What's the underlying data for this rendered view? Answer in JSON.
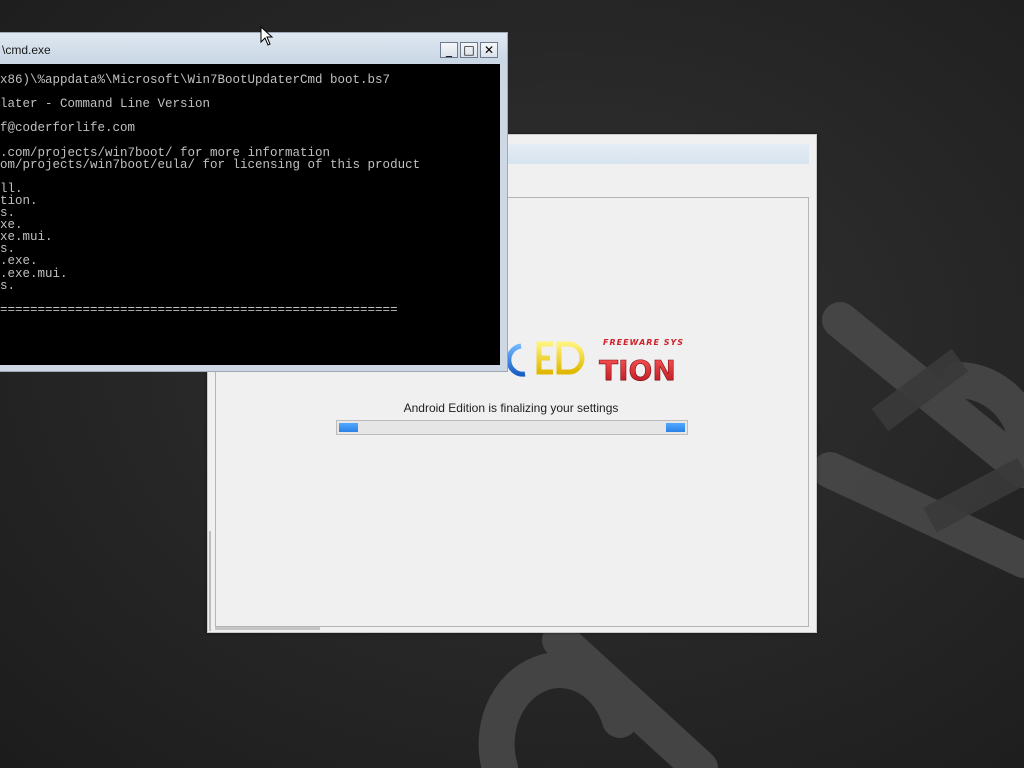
{
  "cmd_window": {
    "title": "\\cmd.exe",
    "minimize_glyph": "_",
    "maximize_glyph": "□",
    "close_glyph": "✕",
    "lines": [
      "x86)\\%appdata%\\Microsoft\\Win7BootUpdaterCmd boot.bs7",
      "",
      "later - Command Line Version",
      "",
      "f@coderforlife.com",
      "",
      ".com/projects/win7boot/ for more information",
      "om/projects/win7boot/eula/ for licensing of this product",
      "",
      "ll.",
      "tion.",
      "s.",
      "xe.",
      "xe.mui.",
      "s.",
      ".exe.",
      ".exe.mui.",
      "s.",
      "",
      "====================================================="
    ],
    "trailing_mark": "]"
  },
  "setup_window": {
    "logo": {
      "text": "EDITION",
      "tagline": "FREEWARE SYS"
    },
    "status_text": "Android Edition is finalizing your settings",
    "progress_style": "marquee"
  },
  "colors": {
    "desktop": "#2a2a2a",
    "console_bg": "#000000",
    "console_text": "#c0c0c0",
    "progress": "#2a82e6",
    "logo_red": "#d0202a",
    "logo_yellow": "#f2d21b",
    "logo_blue": "#1f6fd6"
  }
}
